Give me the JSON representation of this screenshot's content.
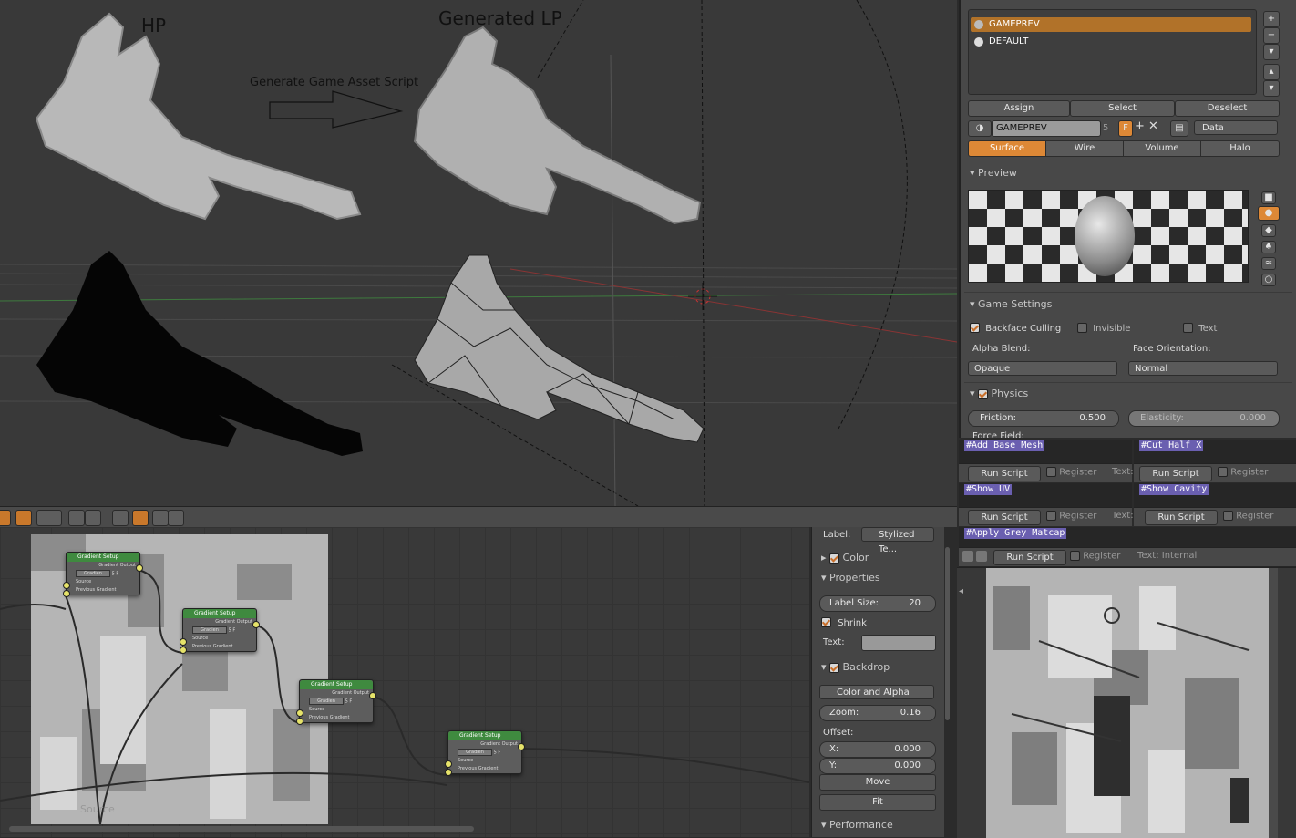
{
  "viewport": {
    "label_hp": "HP",
    "label_generated": "Generated LP",
    "arrow_caption": "Generate Game Asset Script"
  },
  "node_editor": {
    "nodes": [
      {
        "title": "Gradient Setup",
        "output": "Gradient Output",
        "field": "Gradien",
        "num": "5",
        "flag": "F",
        "in1": "Source",
        "in2": "Previous Gradient"
      },
      {
        "title": "Gradient Setup",
        "output": "Gradient Output",
        "field": "Gradien",
        "num": "5",
        "flag": "F",
        "in1": "Source",
        "in2": "Previous Gradient"
      },
      {
        "title": "Gradient Setup",
        "output": "Gradient Output",
        "field": "Gradien",
        "num": "5",
        "flag": "F",
        "in1": "Source",
        "in2": "Previous Gradient"
      },
      {
        "title": "Gradient Setup",
        "output": "Gradient Output",
        "field": "Gradien",
        "num": "5",
        "flag": "F",
        "in1": "Source",
        "in2": "Previous Gradient"
      }
    ],
    "source_label": "Source"
  },
  "node_sidebar": {
    "label_caption": "Label:",
    "label_value": "Stylized Te...",
    "color_panel": "Color",
    "properties_panel": "Properties",
    "label_size_caption": "Label Size:",
    "label_size_value": "20",
    "shrink_label": "Shrink",
    "text_caption": "Text:",
    "backdrop_panel": "Backdrop",
    "backdrop_mode": "Color and Alpha",
    "zoom_caption": "Zoom:",
    "zoom_value": "0.16",
    "offset_caption": "Offset:",
    "x_caption": "X:",
    "x_value": "0.000",
    "y_caption": "Y:",
    "y_value": "0.000",
    "move_label": "Move",
    "fit_label": "Fit",
    "performance_panel": "Performance"
  },
  "properties": {
    "materials": [
      "GAMEPREV",
      "DEFAULT"
    ],
    "assign": "Assign",
    "select": "Select",
    "deselect": "Deselect",
    "material_name": "GAMEPREV",
    "users": "5",
    "fake_user": "F",
    "link_mode": "Data",
    "tabs": [
      "Surface",
      "Wire",
      "Volume",
      "Halo"
    ],
    "preview_panel": "Preview",
    "game_settings_panel": "Game Settings",
    "backface_culling": "Backface Culling",
    "invisible": "Invisible",
    "text": "Text",
    "alpha_blend_caption": "Alpha Blend:",
    "alpha_blend_value": "Opaque",
    "face_orientation_caption": "Face Orientation:",
    "face_orientation_value": "Normal",
    "physics_panel": "Physics",
    "friction_caption": "Friction:",
    "friction_value": "0.500",
    "elasticity_caption": "Elasticity:",
    "elasticity_value": "0.000",
    "force_field_caption": "Force Field:"
  },
  "scripts": {
    "add_base_mesh": "#Add Base Mesh",
    "cut_half_x": "#Cut Half X",
    "show_uv": "#Show UV",
    "show_cavity": "#Show Cavity",
    "apply_grey_matcap": "#Apply Grey Matcap",
    "run_script": "Run Script",
    "register": "Register",
    "text_internal": "Text: Internal",
    "text_short": "Text:"
  }
}
